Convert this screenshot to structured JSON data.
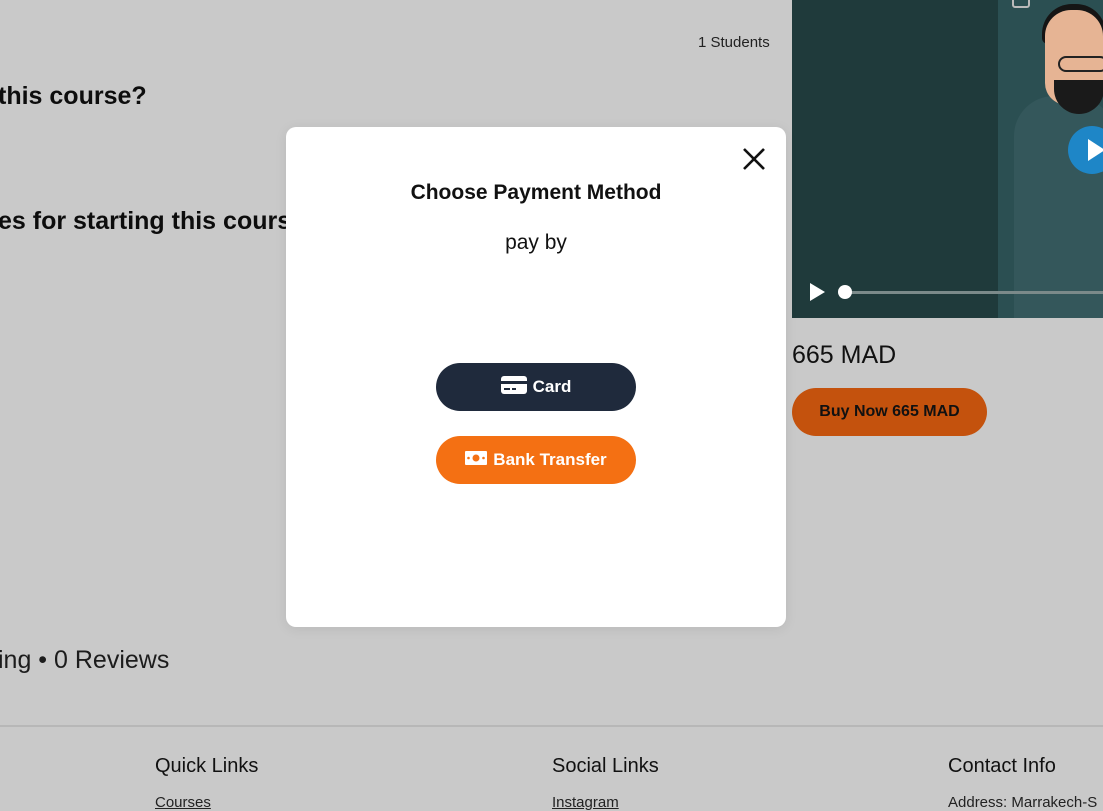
{
  "course": {
    "students": "1 Students",
    "question_1": "this course?",
    "question_2": "es for starting this course",
    "rating_text": "ing • 0 Reviews"
  },
  "sidebar": {
    "price": "665 MAD",
    "buy_button": "Buy Now 665 MAD"
  },
  "modal": {
    "title": "Choose Payment Method",
    "subtitle": "pay by",
    "card_button": "Card",
    "bank_button": "Bank Transfer"
  },
  "footer": {
    "quick_links": {
      "heading": "Quick Links",
      "first_link": "Courses"
    },
    "social_links": {
      "heading": "Social Links",
      "first_link": "Instagram"
    },
    "contact_info": {
      "heading": "Contact Info",
      "address": "Address: Marrakech-S"
    }
  },
  "colors": {
    "overlay_bg": "#c9c9c9",
    "card_button": "#1f2a3c",
    "bank_button": "#f47013",
    "buy_button": "#c4520d",
    "play_button": "#1e86c7"
  },
  "icons": [
    "close-icon",
    "credit-card-icon",
    "cash-icon",
    "play-icon"
  ]
}
